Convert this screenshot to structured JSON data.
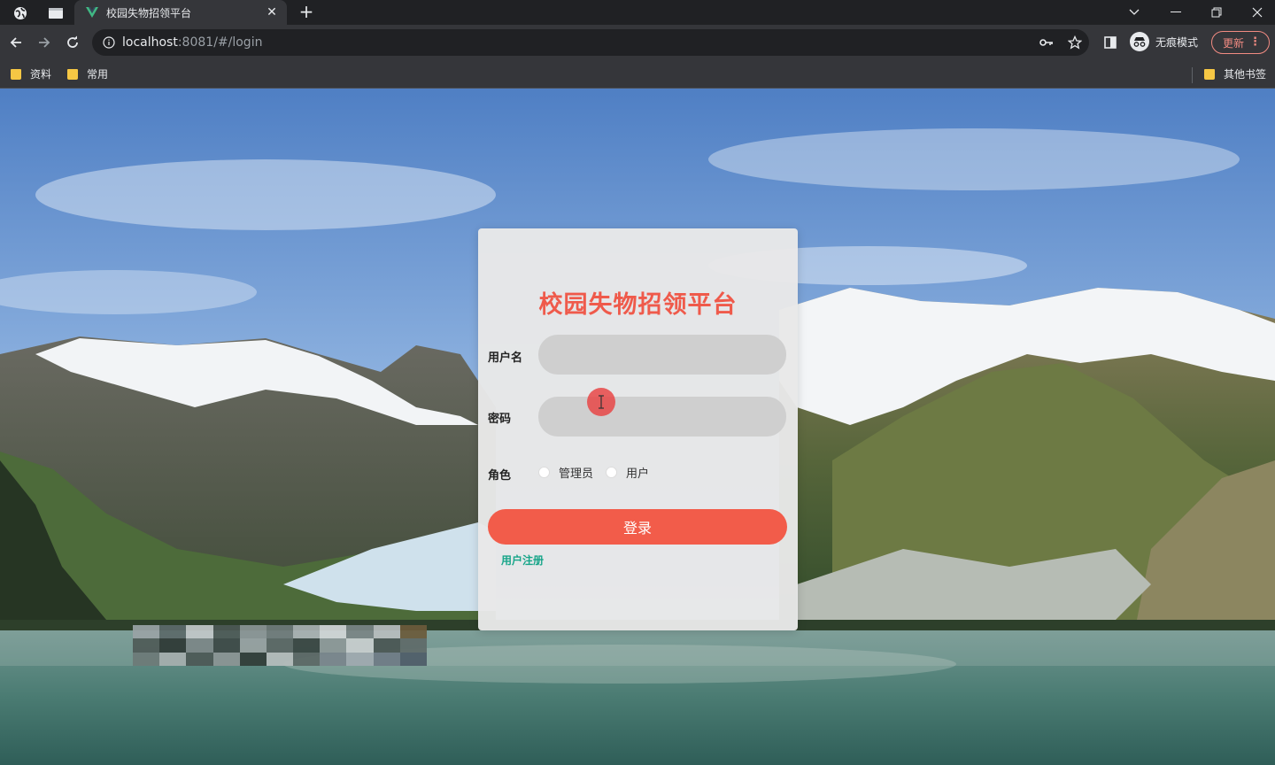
{
  "browser": {
    "tab_title": "校园失物招领平台",
    "url_host": "localhost",
    "url_rest": ":8081/#/login",
    "incognito_label": "无痕模式",
    "update_label": "更新",
    "bookmarks": [
      "资料",
      "常用"
    ],
    "other_bookmarks": "其他书签"
  },
  "login": {
    "title": "校园失物招领平台",
    "username_label": "用户名",
    "username_placeholder": "",
    "password_label": "密码",
    "role_label": "角色",
    "roles": [
      "管理员",
      "用户"
    ],
    "login_button": "登录",
    "register_link": "用户注册"
  },
  "colors": {
    "accent": "#f25c4a",
    "title": "#ef5a4b",
    "link": "#17a589"
  }
}
